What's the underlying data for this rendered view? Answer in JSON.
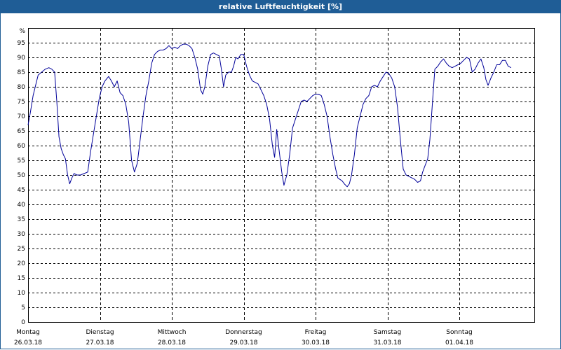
{
  "window": {
    "title": "relative Luftfeuchtigkeit [%]"
  },
  "colors": {
    "titlebar": "#1f5d96",
    "line": "#000099",
    "grid": "#000000",
    "background": "#ffffff"
  },
  "chart_data": {
    "type": "line",
    "title": "relative Luftfeuchtigkeit [%]",
    "ylabel": "%",
    "ylim": [
      0,
      100
    ],
    "yticks": [
      0,
      5,
      10,
      15,
      20,
      25,
      30,
      35,
      40,
      45,
      50,
      55,
      60,
      65,
      70,
      75,
      80,
      85,
      90,
      95
    ],
    "xlim": [
      0,
      7
    ],
    "xunit": "days from Montag 26.03.18 00:00",
    "xticks": [
      {
        "x": 0,
        "day": "Montag",
        "date": "26.03.18"
      },
      {
        "x": 1,
        "day": "Dienstag",
        "date": "27.03.18"
      },
      {
        "x": 2,
        "day": "Mittwoch",
        "date": "28.03.18"
      },
      {
        "x": 3,
        "day": "Donnerstag",
        "date": "29.03.18"
      },
      {
        "x": 4,
        "day": "Freitag",
        "date": "30.03.18"
      },
      {
        "x": 5,
        "day": "Samstag",
        "date": "31.03.18"
      },
      {
        "x": 6,
        "day": "Sonntag",
        "date": "01.04.18"
      }
    ],
    "grid": true,
    "series": [
      {
        "values": [
          [
            0.0,
            67
          ],
          [
            0.03,
            71
          ],
          [
            0.07,
            77
          ],
          [
            0.11,
            81
          ],
          [
            0.14,
            84
          ],
          [
            0.19,
            85
          ],
          [
            0.24,
            86
          ],
          [
            0.29,
            86.5
          ],
          [
            0.33,
            86
          ],
          [
            0.37,
            85
          ],
          [
            0.4,
            75
          ],
          [
            0.43,
            63
          ],
          [
            0.46,
            59
          ],
          [
            0.49,
            57
          ],
          [
            0.52,
            55.5
          ],
          [
            0.55,
            50
          ],
          [
            0.58,
            47
          ],
          [
            0.61,
            49
          ],
          [
            0.64,
            50.5
          ],
          [
            0.68,
            50
          ],
          [
            0.73,
            50
          ],
          [
            0.78,
            50.5
          ],
          [
            0.83,
            51
          ],
          [
            0.87,
            58
          ],
          [
            0.91,
            64
          ],
          [
            0.95,
            70
          ],
          [
            0.99,
            76
          ],
          [
            1.03,
            80
          ],
          [
            1.07,
            82
          ],
          [
            1.12,
            83.5
          ],
          [
            1.16,
            82
          ],
          [
            1.2,
            80
          ],
          [
            1.24,
            82
          ],
          [
            1.28,
            78
          ],
          [
            1.32,
            77
          ],
          [
            1.36,
            74
          ],
          [
            1.4,
            68
          ],
          [
            1.44,
            55
          ],
          [
            1.48,
            51
          ],
          [
            1.52,
            54
          ],
          [
            1.56,
            62
          ],
          [
            1.6,
            70
          ],
          [
            1.64,
            77
          ],
          [
            1.68,
            82
          ],
          [
            1.72,
            88
          ],
          [
            1.76,
            91
          ],
          [
            1.8,
            92
          ],
          [
            1.84,
            92.5
          ],
          [
            1.88,
            92.5
          ],
          [
            1.92,
            93
          ],
          [
            1.96,
            94
          ],
          [
            2.0,
            93
          ],
          [
            2.04,
            93.5
          ],
          [
            2.08,
            93
          ],
          [
            2.12,
            94
          ],
          [
            2.16,
            94.5
          ],
          [
            2.2,
            94.5
          ],
          [
            2.24,
            94
          ],
          [
            2.28,
            93
          ],
          [
            2.32,
            90
          ],
          [
            2.36,
            86
          ],
          [
            2.4,
            79
          ],
          [
            2.43,
            77.5
          ],
          [
            2.46,
            80
          ],
          [
            2.5,
            87
          ],
          [
            2.54,
            91
          ],
          [
            2.58,
            91.5
          ],
          [
            2.62,
            91
          ],
          [
            2.66,
            90.5
          ],
          [
            2.69,
            86
          ],
          [
            2.72,
            80
          ],
          [
            2.75,
            84
          ],
          [
            2.79,
            85
          ],
          [
            2.83,
            85
          ],
          [
            2.86,
            87
          ],
          [
            2.89,
            90
          ],
          [
            2.92,
            89.5
          ],
          [
            2.96,
            91
          ],
          [
            3.0,
            91
          ],
          [
            3.04,
            87
          ],
          [
            3.08,
            84
          ],
          [
            3.12,
            82
          ],
          [
            3.16,
            81.5
          ],
          [
            3.2,
            81
          ],
          [
            3.24,
            79
          ],
          [
            3.28,
            77
          ],
          [
            3.32,
            74
          ],
          [
            3.36,
            69
          ],
          [
            3.4,
            60
          ],
          [
            3.43,
            56
          ],
          [
            3.46,
            65.5
          ],
          [
            3.49,
            59
          ],
          [
            3.53,
            51
          ],
          [
            3.56,
            46.5
          ],
          [
            3.6,
            50
          ],
          [
            3.64,
            57
          ],
          [
            3.68,
            66
          ],
          [
            3.72,
            69
          ],
          [
            3.76,
            72
          ],
          [
            3.8,
            75
          ],
          [
            3.84,
            75.5
          ],
          [
            3.88,
            75
          ],
          [
            3.92,
            76
          ],
          [
            3.96,
            77
          ],
          [
            4.0,
            77.5
          ],
          [
            4.04,
            77.5
          ],
          [
            4.08,
            77
          ],
          [
            4.12,
            74
          ],
          [
            4.16,
            70
          ],
          [
            4.2,
            63
          ],
          [
            4.24,
            57
          ],
          [
            4.28,
            52
          ],
          [
            4.31,
            49
          ],
          [
            4.34,
            48.5
          ],
          [
            4.37,
            48
          ],
          [
            4.4,
            47
          ],
          [
            4.44,
            46
          ],
          [
            4.47,
            47
          ],
          [
            4.5,
            50
          ],
          [
            4.54,
            57
          ],
          [
            4.58,
            66
          ],
          [
            4.62,
            70
          ],
          [
            4.66,
            74
          ],
          [
            4.7,
            76
          ],
          [
            4.74,
            77
          ],
          [
            4.78,
            80
          ],
          [
            4.82,
            80.5
          ],
          [
            4.86,
            80
          ],
          [
            4.9,
            82
          ],
          [
            4.94,
            83.5
          ],
          [
            4.98,
            85
          ],
          [
            5.02,
            84.5
          ],
          [
            5.06,
            83
          ],
          [
            5.1,
            80
          ],
          [
            5.14,
            73
          ],
          [
            5.18,
            62
          ],
          [
            5.22,
            52
          ],
          [
            5.26,
            50
          ],
          [
            5.3,
            49.5
          ],
          [
            5.34,
            49
          ],
          [
            5.38,
            48.5
          ],
          [
            5.42,
            47.5
          ],
          [
            5.46,
            48
          ],
          [
            5.49,
            51
          ],
          [
            5.52,
            53
          ],
          [
            5.56,
            55.5
          ],
          [
            5.59,
            62
          ],
          [
            5.63,
            76
          ],
          [
            5.66,
            86
          ],
          [
            5.7,
            87
          ],
          [
            5.74,
            88.5
          ],
          [
            5.78,
            89.5
          ],
          [
            5.82,
            88
          ],
          [
            5.86,
            87
          ],
          [
            5.9,
            86.5
          ],
          [
            5.94,
            87
          ],
          [
            5.98,
            87.5
          ],
          [
            6.02,
            88
          ],
          [
            6.06,
            89
          ],
          [
            6.1,
            90
          ],
          [
            6.14,
            89.5
          ],
          [
            6.18,
            85
          ],
          [
            6.22,
            86
          ],
          [
            6.26,
            88
          ],
          [
            6.3,
            89.5
          ],
          [
            6.34,
            86.5
          ],
          [
            6.37,
            82.5
          ],
          [
            6.4,
            80.5
          ],
          [
            6.44,
            83
          ],
          [
            6.48,
            85
          ],
          [
            6.52,
            87.5
          ],
          [
            6.56,
            87.5
          ],
          [
            6.6,
            89
          ],
          [
            6.64,
            89
          ],
          [
            6.68,
            87
          ],
          [
            6.72,
            86.5
          ]
        ]
      }
    ]
  }
}
